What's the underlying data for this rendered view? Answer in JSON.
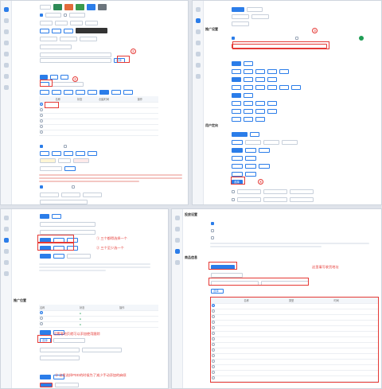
{
  "annotations": {
    "num1": "①",
    "num2": "②",
    "num3": "③",
    "num4": "④",
    "note_p3_a": "① 三个都得选择一个",
    "note_p3_b": "② 三个至少选一个",
    "note_p3_c": "设置落地页就可以添加使用跟踪",
    "note_p3_d": "③ 这里选择PDD的时候为了减少手动添加的麻烦",
    "note_p4": "这里填写收货地址"
  },
  "p1": {
    "rows": [
      {
        "label": "推广目标",
        "value": ""
      },
      {
        "label": "推广方式",
        "value": ""
      },
      {
        "label": "投放范围",
        "value": ""
      },
      {
        "label": "投放形式",
        "value": ""
      },
      {
        "label": "优化目标",
        "value": ""
      },
      {
        "label": "转化目标",
        "value": ""
      },
      {
        "label": "出价方式",
        "value": ""
      },
      {
        "label": "投放时间",
        "value": ""
      }
    ],
    "button": "选择",
    "table_headers": [
      "",
      "名称",
      "状态",
      "创建时间",
      "操作"
    ]
  },
  "p2": {
    "section1": "推广设置",
    "section2": "用户定向",
    "select_btn": "选择",
    "add_btn": "新建"
  },
  "p3": {
    "section": "推广位置",
    "table_headers": [
      "名称",
      "状态",
      "操作"
    ],
    "select_btn": "选择"
  },
  "p4": {
    "section1": "投放设置",
    "section2": "商品信息",
    "table_headers": [
      "",
      "名称",
      "类型",
      "时间"
    ],
    "select_btn": "选择"
  }
}
